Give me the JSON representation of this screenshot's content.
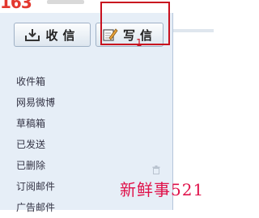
{
  "header": {
    "logo_text": "163"
  },
  "toolbar": {
    "receive_label": "收信",
    "compose_label": "写信",
    "receive_icon": "inbox-download-icon",
    "compose_icon": "pencil-note-icon"
  },
  "annotation": {
    "marker": "1",
    "color": "#c8101e"
  },
  "folders": [
    {
      "label": "收件箱"
    },
    {
      "label": "网易微博"
    },
    {
      "label": "草稿箱"
    },
    {
      "label": "已发送"
    },
    {
      "label": "已删除",
      "icon": "trash-icon"
    },
    {
      "label": "订阅邮件"
    },
    {
      "label": "广告邮件"
    }
  ],
  "watermark": {
    "text": "新鲜事521"
  },
  "colors": {
    "sidebar_bg": "#e6eef7",
    "highlight": "#c8101e",
    "watermark": "#e0114a"
  }
}
